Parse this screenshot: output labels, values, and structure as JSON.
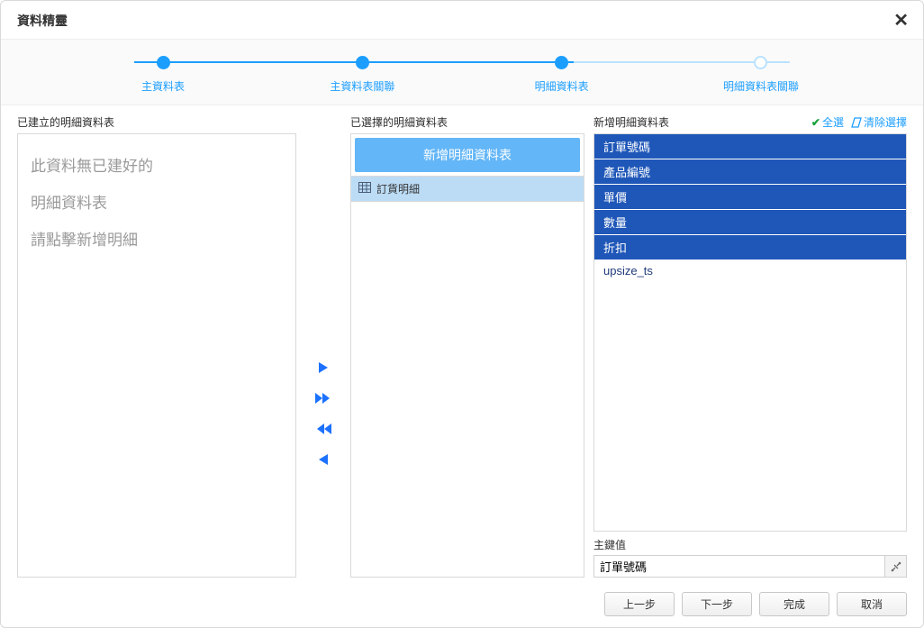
{
  "dialog": {
    "title": "資料精靈"
  },
  "stepper": {
    "steps": [
      {
        "label": "主資料表",
        "done": true
      },
      {
        "label": "主資料表關聯",
        "done": true
      },
      {
        "label": "明細資料表",
        "done": true
      },
      {
        "label": "明細資料表關聯",
        "done": false
      }
    ]
  },
  "left": {
    "heading": "已建立的明細資料表",
    "placeholder_lines": [
      "此資料無已建好的",
      "明細資料表",
      "請點擊新增明細"
    ]
  },
  "mid": {
    "heading": "已選擇的明細資料表",
    "add_button": "新增明細資料表",
    "items": [
      {
        "label": "訂貨明細"
      }
    ]
  },
  "right": {
    "heading": "新增明細資料表",
    "select_all": "全選",
    "clear_all": "清除選擇",
    "fields": [
      {
        "label": "訂單號碼",
        "selected": true
      },
      {
        "label": "產品編號",
        "selected": true
      },
      {
        "label": "單價",
        "selected": true
      },
      {
        "label": "數量",
        "selected": true
      },
      {
        "label": "折扣",
        "selected": true
      },
      {
        "label": "upsize_ts",
        "selected": false
      }
    ],
    "pk_label": "主鍵值",
    "pk_value": "訂單號碼"
  },
  "footer": {
    "prev": "上一步",
    "next": "下一步",
    "finish": "完成",
    "cancel": "取消"
  }
}
